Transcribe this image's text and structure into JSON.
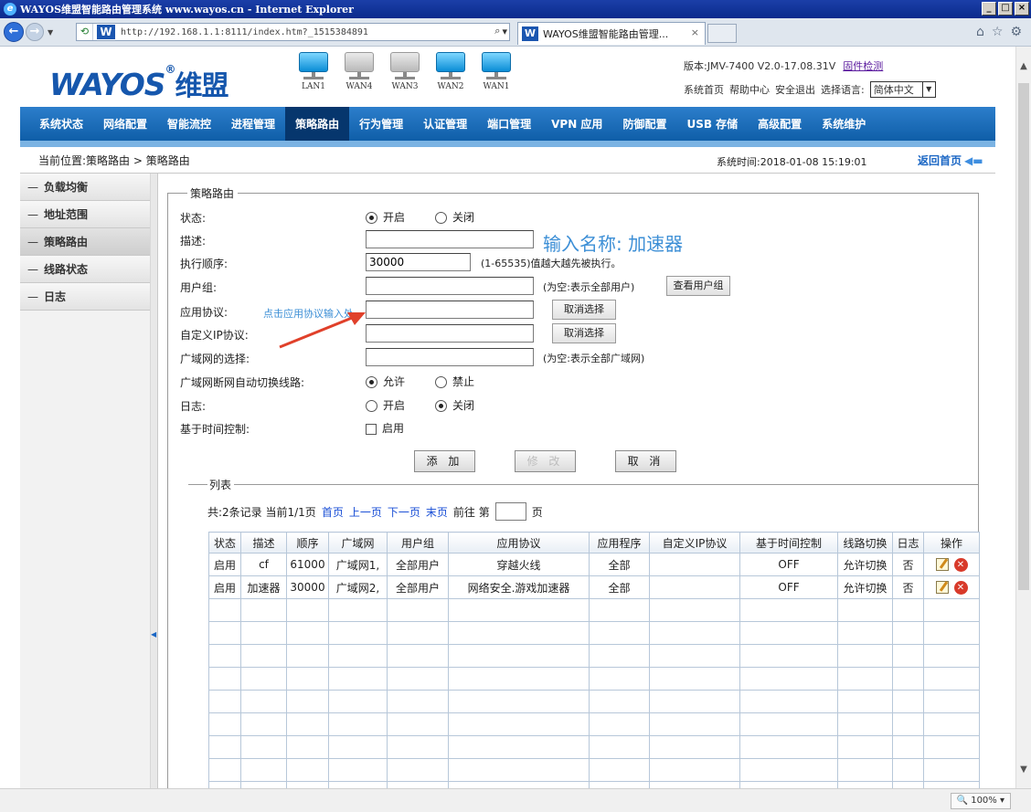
{
  "browser": {
    "title": "WAYOS维盟智能路由管理系统 www.wayos.cn - Internet Explorer",
    "url": "http://192.168.1.1:8111/index.htm?_1515384891",
    "tab_title": "WAYOS维盟智能路由管理...",
    "zoom": "100%"
  },
  "header": {
    "logo": "WAYOS",
    "logo_reg": "®",
    "logo_cn": "维盟",
    "ports": [
      "LAN1",
      "WAN4",
      "WAN3",
      "WAN2",
      "WAN1"
    ],
    "version": "版本:JMV-7400 V2.0-17.08.31V",
    "firmware_link": "固件检测",
    "links": [
      "系统首页",
      "帮助中心",
      "安全退出"
    ],
    "language_label": "选择语言:",
    "language_value": "简体中文"
  },
  "menu": [
    "系统状态",
    "网络配置",
    "智能流控",
    "进程管理",
    "策略路由",
    "行为管理",
    "认证管理",
    "端口管理",
    "VPN 应用",
    "防御配置",
    "USB 存储",
    "高级配置",
    "系统维护"
  ],
  "breadcrumb": "当前位置:策略路由 > 策略路由",
  "system_time": "系统时间:2018-01-08 15:19:01",
  "home_link": "返回首页",
  "sidebar": [
    "负载均衡",
    "地址范围",
    "策略路由",
    "线路状态",
    "日志"
  ],
  "form": {
    "legend": "策略路由",
    "status_label": "状态:",
    "status_on": "开启",
    "status_off": "关闭",
    "desc_label": "描述:",
    "desc_value": "",
    "order_label": "执行顺序:",
    "order_value": "30000",
    "order_hint": "(1-65535)值越大越先被执行。",
    "usergroup_label": "用户组:",
    "usergroup_hint": "(为空:表示全部用户)",
    "view_usergroup_btn": "查看用户组",
    "app_label": "应用协议:",
    "cancel_select_btn": "取消选择",
    "custom_ip_label": "自定义IP协议:",
    "cancel_select_btn2": "取消选择",
    "wan_label": "广域网的选择:",
    "wan_hint": "(为空:表示全部广域网)",
    "autoswitch_label": "广域网断网自动切换线路:",
    "allow": "允许",
    "forbid": "禁止",
    "log_label": "日志:",
    "log_on": "开启",
    "log_off": "关闭",
    "time_label": "基于时间控制:",
    "time_enable": "启用",
    "add_btn": "添 加",
    "modify_btn": "修 改",
    "cancel_btn": "取 消"
  },
  "annotations": {
    "input_name": "输入名称: 加速器",
    "click_app": "点击应用协议输入处"
  },
  "list": {
    "legend": "列表",
    "summary": "共:2条记录 当前1/1页",
    "first": "首页",
    "prev": "上一页",
    "next": "下一页",
    "last": "末页",
    "goto_label": "前往 第",
    "page_suffix": "页",
    "columns": [
      "状态",
      "描述",
      "顺序",
      "广域网",
      "用户组",
      "应用协议",
      "应用程序",
      "自定义IP协议",
      "基于时间控制",
      "线路切换",
      "日志",
      "操作"
    ],
    "rows": [
      [
        "启用",
        "cf",
        "61000",
        "广域网1,",
        "全部用户",
        "穿越火线",
        "全部",
        "",
        "OFF",
        "允许切换",
        "否"
      ],
      [
        "启用",
        "加速器",
        "30000",
        "广域网2,",
        "全部用户",
        "网络安全.游戏加速器",
        "全部",
        "",
        "OFF",
        "允许切换",
        "否"
      ]
    ]
  }
}
